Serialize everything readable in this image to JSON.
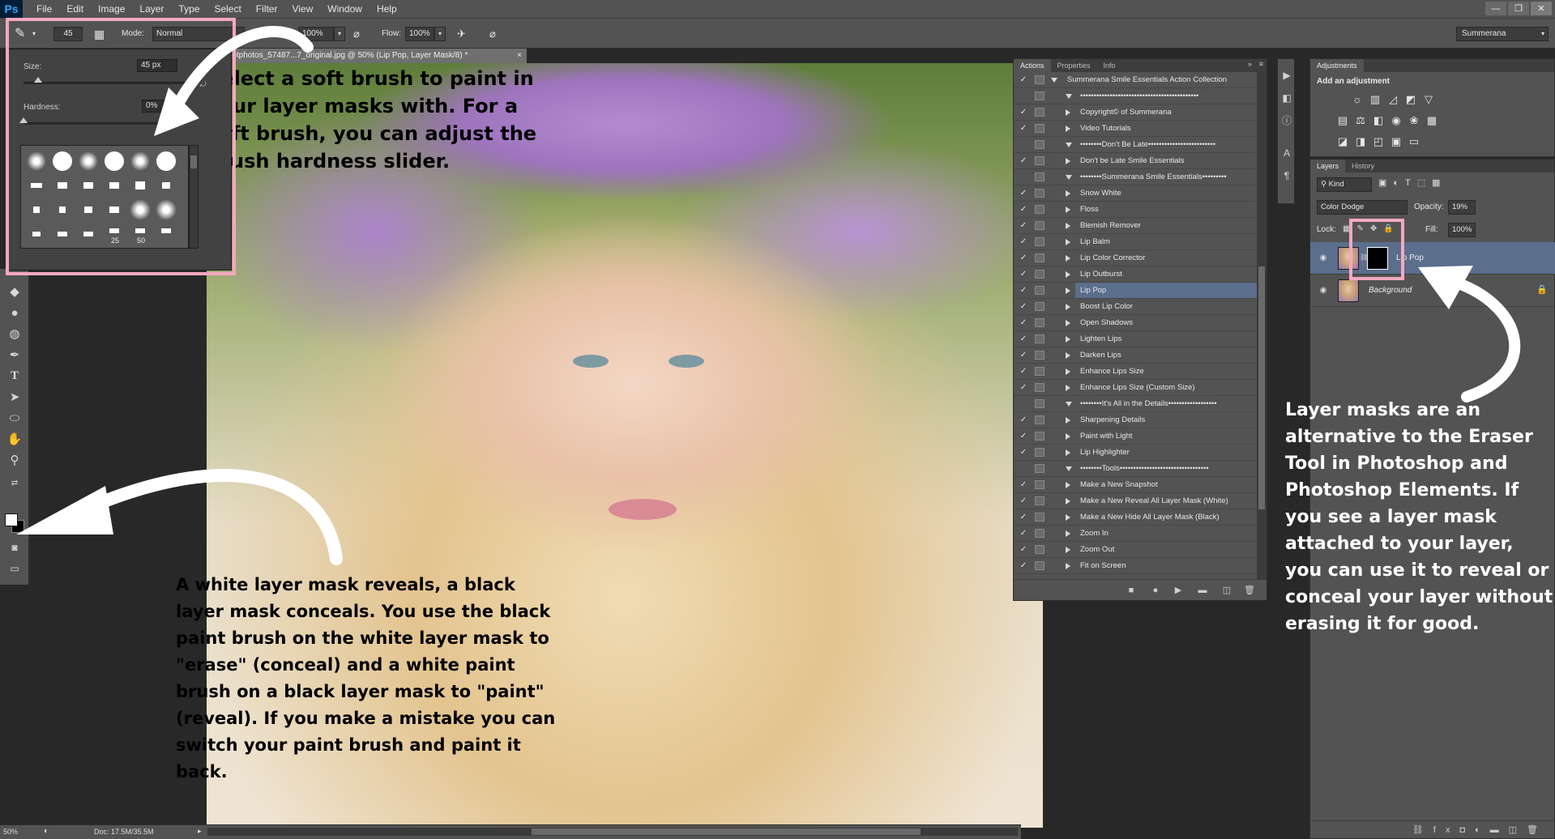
{
  "app": {
    "logo": "Ps",
    "menu": [
      "File",
      "Edit",
      "Image",
      "Layer",
      "Type",
      "Select",
      "Filter",
      "View",
      "Window",
      "Help"
    ],
    "window_buttons": [
      "—",
      "❐",
      "✕"
    ]
  },
  "options_bar": {
    "brush_size": "45",
    "mode_label": "Mode:",
    "mode_value": "Normal",
    "opacity_label": "Opacity:",
    "opacity_value": "100%",
    "flow_label": "Flow:",
    "flow_value": "100%",
    "workspace": "Summerana"
  },
  "brush_popup": {
    "size_label": "Size:",
    "size_value": "45 px",
    "size_fraction": 0.09,
    "hardness_label": "Hardness:",
    "hardness_value": "0%",
    "hardness_fraction": 0.0,
    "preset_numbers": [
      "25",
      "50"
    ]
  },
  "document": {
    "tab_title": "...otphotos_57487...7_original.jpg @ 50% (Lip Pop, Layer Mask/8) *",
    "zoom": "50%",
    "doc_info": "Doc: 17.5M/35.5M"
  },
  "annotations": {
    "brush_note": "Select a soft brush to paint in your layer masks with. For a soft brush, you can adjust the brush hardness slider.",
    "mask_note": "A white layer mask reveals, a black layer mask conceals. You use the black paint brush on the white layer mask to \"erase\" (conceal) and a white paint brush on a black layer mask to \"paint\" (reveal). If you make a mistake you can switch your paint brush and paint it back.",
    "eraser_note": "Layer masks are an alternative to the Eraser Tool in Photoshop and Photoshop Elements. If you see a layer mask attached to your layer, you can use it to reveal or conceal your layer without erasing it for good.",
    "highlight_color": "#f4a8c0"
  },
  "actions_panel": {
    "tabs": [
      "Actions",
      "Properties",
      "Info"
    ],
    "items": [
      {
        "label": "Summerana Smile Essentials Action Collection",
        "level": 0,
        "expanded": true,
        "checked": true
      },
      {
        "label": "••••••••••••••••••••••••••••••••••••••••••••",
        "level": 1,
        "expanded": true,
        "checked": false
      },
      {
        "label": "Copyright© of Summerana",
        "level": 1,
        "expanded": false,
        "checked": true
      },
      {
        "label": "Video Tutorials",
        "level": 1,
        "expanded": false,
        "checked": true
      },
      {
        "label": "••••••••Don't Be Late•••••••••••••••••••••••••",
        "level": 1,
        "expanded": true,
        "checked": false
      },
      {
        "label": "Don't be Late Smile Essentials",
        "level": 1,
        "expanded": false,
        "checked": true
      },
      {
        "label": "••••••••Summerana Smile Essentials•••••••••",
        "level": 1,
        "expanded": true,
        "checked": false
      },
      {
        "label": "Snow White",
        "level": 1,
        "expanded": false,
        "checked": true
      },
      {
        "label": "Floss",
        "level": 1,
        "expanded": false,
        "checked": true
      },
      {
        "label": "Blemish Remover",
        "level": 1,
        "expanded": false,
        "checked": true
      },
      {
        "label": "Lip Balm",
        "level": 1,
        "expanded": false,
        "checked": true
      },
      {
        "label": "Lip Color Corrector",
        "level": 1,
        "expanded": false,
        "checked": true
      },
      {
        "label": "Lip Outburst",
        "level": 1,
        "expanded": false,
        "checked": true
      },
      {
        "label": "Lip Pop",
        "level": 1,
        "expanded": false,
        "checked": true,
        "selected": true
      },
      {
        "label": "Boost Lip Color",
        "level": 1,
        "expanded": false,
        "checked": true
      },
      {
        "label": "Open Shadows",
        "level": 1,
        "expanded": false,
        "checked": true
      },
      {
        "label": "Lighten Lips",
        "level": 1,
        "expanded": false,
        "checked": true
      },
      {
        "label": "Darken Lips",
        "level": 1,
        "expanded": false,
        "checked": true
      },
      {
        "label": "Enhance Lips Size",
        "level": 1,
        "expanded": false,
        "checked": true
      },
      {
        "label": "Enhance Lips Size (Custom Size)",
        "level": 1,
        "expanded": false,
        "checked": true
      },
      {
        "label": "••••••••It's All in the Details••••••••••••••••••",
        "level": 1,
        "expanded": true,
        "checked": false
      },
      {
        "label": "Sharpening Details",
        "level": 1,
        "expanded": false,
        "checked": true
      },
      {
        "label": "Paint with Light",
        "level": 1,
        "expanded": false,
        "checked": true
      },
      {
        "label": "Lip Highlighter",
        "level": 1,
        "expanded": false,
        "checked": true
      },
      {
        "label": "••••••••Tools•••••••••••••••••••••••••••••••••",
        "level": 1,
        "expanded": true,
        "checked": false
      },
      {
        "label": "Make a New Snapshot",
        "level": 1,
        "expanded": false,
        "checked": true
      },
      {
        "label": "Make a New Reveal All Layer Mask (White)",
        "level": 1,
        "expanded": false,
        "checked": true
      },
      {
        "label": "Make a New Hide All Layer Mask (Black)",
        "level": 1,
        "expanded": false,
        "checked": true
      },
      {
        "label": "Zoom In",
        "level": 1,
        "expanded": false,
        "checked": true
      },
      {
        "label": "Zoom Out",
        "level": 1,
        "expanded": false,
        "checked": true
      },
      {
        "label": "Fit on Screen",
        "level": 1,
        "expanded": false,
        "checked": true
      }
    ],
    "footer_icons": [
      "stop-icon",
      "record-icon",
      "play-icon",
      "folder-icon",
      "new-action-icon",
      "trash-icon"
    ]
  },
  "adjustments_panel": {
    "tab": "Adjustments",
    "subtitle": "Add an adjustment"
  },
  "layers_panel": {
    "tabs": [
      "Layers",
      "History"
    ],
    "kind_filter": "Kind",
    "blend_mode": "Color Dodge",
    "opacity_label": "Opacity:",
    "opacity_value": "19%",
    "lock_label": "Lock:",
    "fill_label": "Fill:",
    "fill_value": "100%",
    "layers": [
      {
        "name": "Lip Pop",
        "has_mask": true,
        "active": true,
        "italic": false,
        "locked": false
      },
      {
        "name": "Background",
        "has_mask": false,
        "active": false,
        "italic": true,
        "locked": true
      }
    ]
  }
}
